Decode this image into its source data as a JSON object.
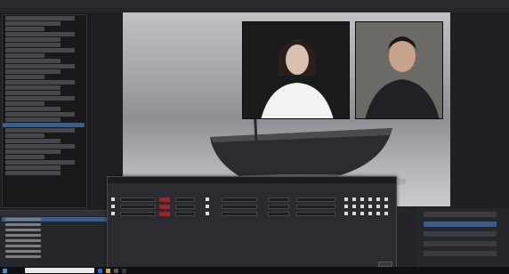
{
  "colors": {
    "accent": "#3a5d8f",
    "meter_red": "#a52222",
    "panel_bg": "#2b2c31"
  },
  "preview": {
    "content": "",
    "sources": []
  },
  "mixer": {
    "title": "",
    "columns": [],
    "rows": [
      {
        "name": "",
        "status": "",
        "volume": "",
        "mono": false,
        "balance": "",
        "sync_offset": "",
        "audio_monitoring": "",
        "tracks": [
          true,
          true,
          true,
          true,
          true,
          true
        ]
      },
      {
        "name": "",
        "status": "",
        "volume": "",
        "mono": false,
        "balance": "",
        "sync_offset": "",
        "audio_monitoring": "",
        "tracks": [
          true,
          true,
          true,
          true,
          true,
          true
        ]
      },
      {
        "name": "",
        "status": "",
        "volume": "",
        "mono": false,
        "balance": "",
        "sync_offset": "",
        "audio_monitoring": "",
        "tracks": [
          true,
          true,
          true,
          true,
          true,
          true
        ]
      }
    ],
    "close_label": ""
  },
  "scenes": {
    "items": [],
    "selected_index": 20
  },
  "sources": {
    "header": "",
    "items": []
  },
  "controls": {
    "header": "",
    "buttons": []
  },
  "taskbar": {
    "search_placeholder": ""
  }
}
